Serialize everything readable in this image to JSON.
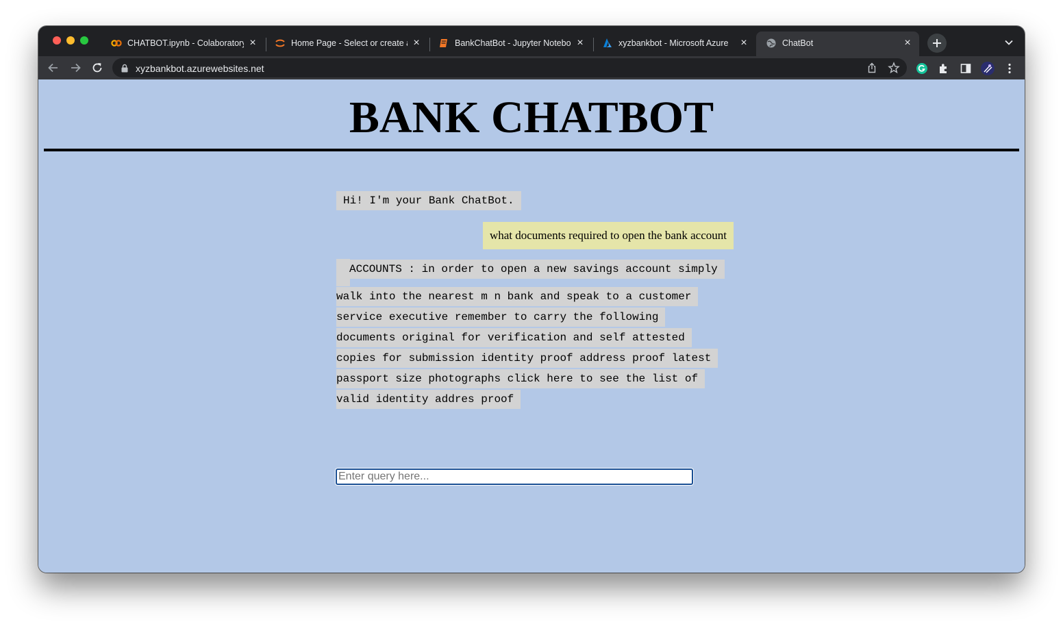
{
  "browser": {
    "tabs": [
      {
        "title": "CHATBOT.ipynb - Colaboratory",
        "icon": "colab-icon"
      },
      {
        "title": "Home Page - Select or create a",
        "icon": "jupyter-icon"
      },
      {
        "title": "BankChatBot - Jupyter Notebook",
        "icon": "notebook-icon"
      },
      {
        "title": "xyzbankbot - Microsoft Azure",
        "icon": "azure-icon"
      },
      {
        "title": "ChatBot",
        "icon": "globe-icon",
        "active": true
      }
    ],
    "url": "xyzbankbot.azurewebsites.net"
  },
  "page": {
    "title": "BANK CHATBOT",
    "messages": [
      {
        "role": "bot",
        "text": "Hi! I'm your Bank ChatBot."
      },
      {
        "role": "user",
        "text": "what documents required to open the bank account"
      },
      {
        "role": "bot",
        "text": "ACCOUNTS : in order to open a new savings account simply walk into the nearest m n bank and speak to a customer service executive remember to carry the following documents original for verification and self attested copies for submission identity proof address proof latest passport size photographs click here to see the list of valid identity addres proof "
      }
    ],
    "input": {
      "placeholder": "Enter query here...",
      "value": ""
    }
  },
  "colors": {
    "page_background": "#b3c8e7",
    "bot_bubble": "#d3d3d3",
    "user_bubble": "#e5e5a9",
    "tabstrip": "#202124",
    "toolbar": "#35363a"
  }
}
